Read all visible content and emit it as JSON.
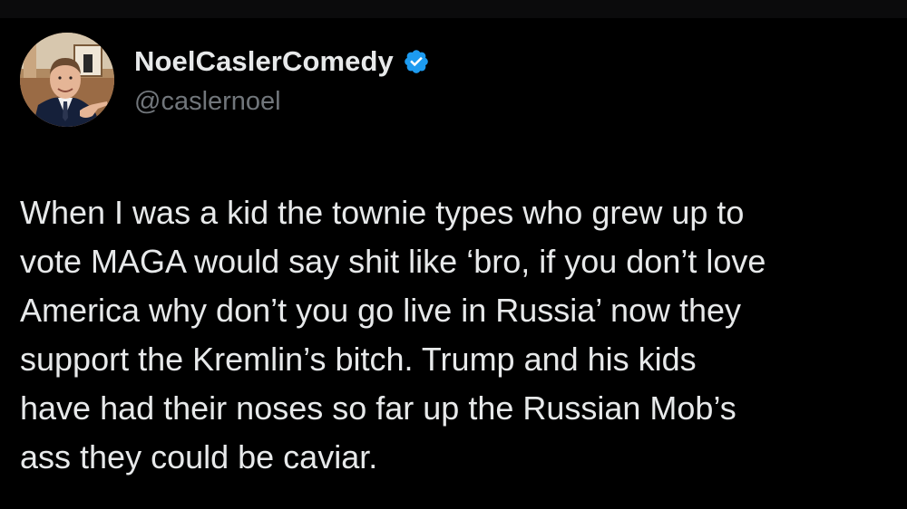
{
  "colors": {
    "background": "#000000",
    "primary_text": "#e7e9ea",
    "secondary_text": "#71767b",
    "verified_badge": "#1d9bf0"
  },
  "author": {
    "display_name": "NoelCaslerComedy",
    "handle": "@caslernoel",
    "verified_icon": "verified-badge-icon",
    "avatar_icon": "profile-photo"
  },
  "tweet": {
    "lines": [
      "When I was a kid the townie types who grew up to",
      "vote MAGA would say shit like ‘bro, if you don’t love",
      "America why don’t you go live in Russia’ now they",
      "support the Kremlin’s bitch. Trump and his kids",
      "have had their noses so far up the Russian Mob’s",
      "ass they could be caviar."
    ]
  }
}
